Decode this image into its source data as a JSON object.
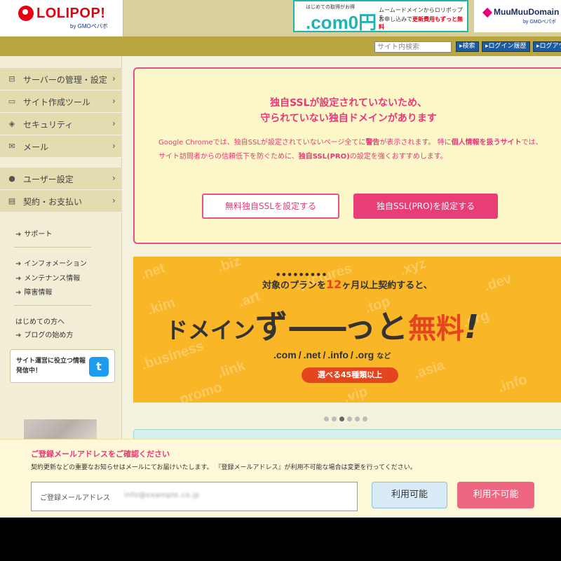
{
  "header": {
    "logo_text": "LOLIPOP!",
    "logo_sub": "by GMOペパボ",
    "ad_com": {
      "small": "はじめての取得がお得",
      "big": ".com0円",
      "line1": "ムームードメインからロリポップを",
      "line2_prefix": "お申し込みで",
      "line2_highlight": "更新費用もずっと無料"
    },
    "ad_muumuu": {
      "name": "MuuMuuDomain",
      "sub": "by GMOペパボ"
    }
  },
  "toolbar": {
    "search_placeholder": "サイト内検索",
    "search_button": "検索",
    "login_history": "ログイン履歴",
    "logout": "ログアウ"
  },
  "sidebar": {
    "nav": [
      {
        "label": "サーバーの管理・設定",
        "icon": "server-icon"
      },
      {
        "label": "サイト作成ツール",
        "icon": "laptop-icon"
      },
      {
        "label": "セキュリティ",
        "icon": "shield-icon"
      },
      {
        "label": "メール",
        "icon": "mail-icon"
      },
      {
        "label": "ユーザー設定",
        "icon": "user-icon"
      },
      {
        "label": "契約・お支払い",
        "icon": "card-icon"
      }
    ],
    "support": "サポート",
    "info_links": [
      "インフォメーション",
      "メンテナンス情報",
      "障害情報"
    ],
    "beginner": "はじめての方へ",
    "blog": "ブログの始め方",
    "twitter_text": "サイト運営に役立つ情報発信中！"
  },
  "ssl_warning": {
    "title_line1": "独自SSLが設定されていないため、",
    "title_line2": "守られていない独自ドメインがあります",
    "body_1": "Google Chromeでは、独自SSLが設定されていないページ全てに",
    "body_warn": "警告",
    "body_2": "が表示されます。 特に",
    "body_personal": "個人情報を扱うサイト",
    "body_3": "では、サイト訪問者からの信頼低下を防ぐために、",
    "body_pro": "独自SSL(PRO)",
    "body_4": "の設定を強くおすすめします。",
    "btn_free": "無料独自SSLを設定する",
    "btn_pro": "独自SSL(PRO)を設定する"
  },
  "banner": {
    "line1_prefix": "対象のプランを",
    "line1_highlight": "12",
    "line1_suffix": "ヶ月以上契約すると、",
    "headline_a": "ドメイン",
    "headline_b": "ず",
    "headline_c": "——",
    "headline_d": "っと",
    "headline_e": "無料",
    "headline_f": "!",
    "tlds": [
      ".com",
      ".net",
      ".info",
      ".org"
    ],
    "tlds_suffix": "など",
    "pill": "選べる45種類以上",
    "watermark": [
      ".net",
      ".biz",
      ".pictures",
      ".xyz",
      ".dev",
      ".kim",
      ".art",
      ".top",
      ".org",
      ".business",
      ".link",
      ".asia",
      ".info",
      ".promo",
      ".vip"
    ]
  },
  "carousel": {
    "count": 6,
    "active": 2
  },
  "email_notice": {
    "title": "ご登録メールアドレスをご確認ください",
    "desc": "契約更新などの重要なお知らせはメールにてお届けいたします。 『登録メールアドレス』が利用不可能な場合は変更を行ってください。",
    "field_label": "ご登録メールアドレス",
    "field_value": "info@example.co.jp",
    "btn_ok": "利用可能",
    "btn_ng": "利用不可能"
  },
  "colors": {
    "brand_red": "#e60012",
    "warning_pink": "#e8387a",
    "banner_yellow": "#f9b627",
    "toolbar_olive": "#b9a641"
  }
}
